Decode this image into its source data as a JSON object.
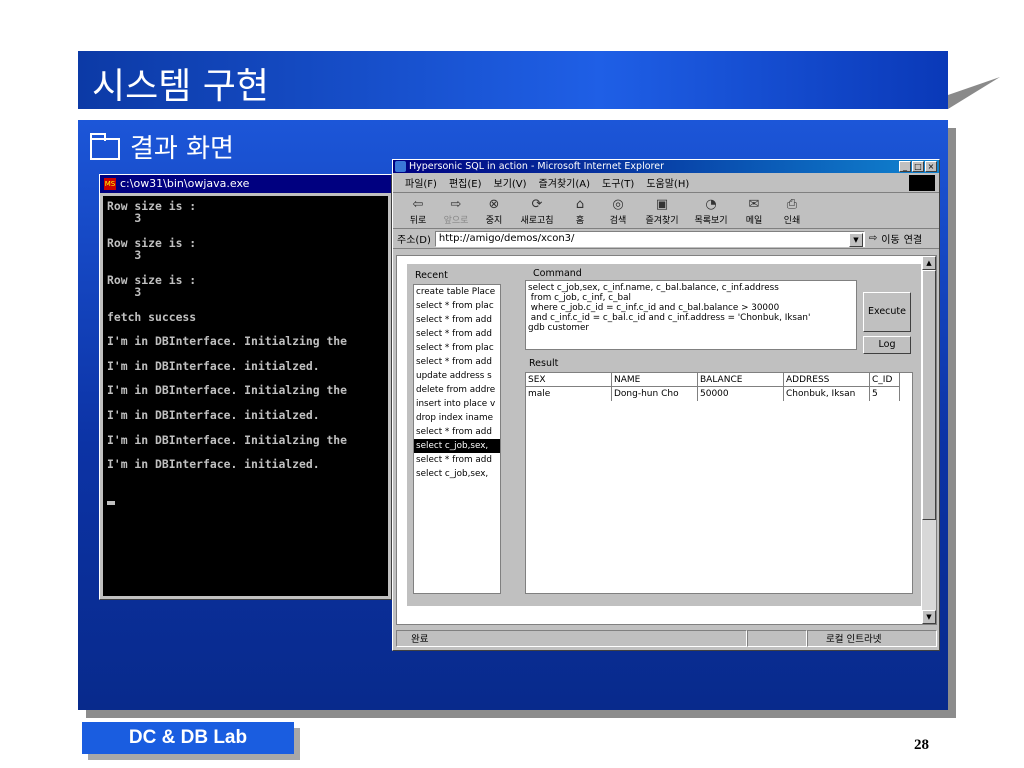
{
  "slide": {
    "title": "시스템 구현",
    "subtitle": "결과 화면",
    "footer_lab": "DC & DB Lab",
    "page_number": "28"
  },
  "console": {
    "title": "c:\\ow31\\bin\\owjava.exe",
    "lines": [
      "Row size is :",
      "    3",
      "",
      "Row size is :",
      "    3",
      "",
      "Row size is :",
      "    3",
      "",
      "fetch success",
      "",
      "I'm in DBInterface. Initialzing the",
      "",
      "I'm in DBInterface. initialzed.",
      "",
      "I'm in DBInterface. Initialzing the",
      "",
      "I'm in DBInterface. initialzed.",
      "",
      "I'm in DBInterface. Initialzing the",
      "",
      "I'm in DBInterface. initialzed."
    ]
  },
  "ie": {
    "title": "Hypersonic SQL in action - Microsoft Internet Explorer",
    "menu": [
      "파일(F)",
      "편집(E)",
      "보기(V)",
      "즐겨찾기(A)",
      "도구(T)",
      "도움말(H)"
    ],
    "toolbar": [
      "뒤로",
      "앞으로",
      "중지",
      "새로고침",
      "홈",
      "검색",
      "즐겨찾기",
      "목록보기",
      "메일",
      "인쇄"
    ],
    "address_label": "주소(D)",
    "address_value": "http://amigo/demos/xcon3/",
    "go_label": "이동",
    "links_label": "연결",
    "status_text": "완료",
    "zone_text": "로컬 인트라넷"
  },
  "applet": {
    "recent_label": "Recent",
    "recent_items": [
      "create table Place",
      "select * from plac",
      "select * from add",
      "select * from add",
      "select * from plac",
      "select * from add",
      "update address s",
      "delete from addre",
      "insert into place v",
      "drop index iname",
      "select * from add",
      "select c_job,sex,",
      "select * from add",
      "select c_job,sex,"
    ],
    "selected_index": 11,
    "command_label": "Command",
    "command_text": "select c_job,sex, c_inf.name, c_bal.balance, c_inf.address\n from c_job, c_inf, c_bal\n where c_job.c_id = c_inf.c_id and c_bal.balance > 30000\n and c_inf.c_id = c_bal.c_id and c_inf.address = 'Chonbuk, Iksan'\ngdb customer",
    "execute_label": "Execute",
    "log_label": "Log",
    "result_label": "Result",
    "result_columns": [
      "SEX",
      "NAME",
      "BALANCE",
      "ADDRESS",
      "C_ID"
    ],
    "result_rows": [
      [
        "male",
        "Dong-hun Cho",
        "50000",
        "Chonbuk, Iksan",
        "5"
      ]
    ]
  },
  "colors": {
    "slide_blue": "#1f5fe6",
    "window_title": "#000080",
    "console_bg": "#000000"
  }
}
